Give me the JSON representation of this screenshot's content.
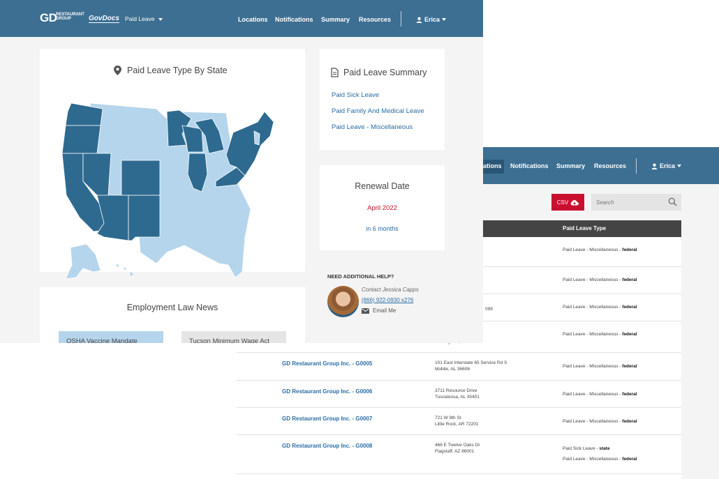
{
  "back_window": {
    "nav": {
      "items": [
        "ations",
        "Notifications",
        "Summary",
        "Resources"
      ],
      "user": "Erica"
    },
    "toolbar": {
      "csv_label": "CSV",
      "search_placeholder": "Search"
    },
    "table": {
      "header_type": "Paid Leave Type",
      "partial_rows": [
        {
          "address_line": "",
          "types": [
            {
              "category": "Paid Leave - Miscellaneous",
              "level": "federal"
            }
          ]
        },
        {
          "address_line": "",
          "types": [
            {
              "category": "Paid Leave - Miscellaneous",
              "level": "federal"
            }
          ]
        },
        {
          "address_line": "099",
          "types": [
            {
              "category": "Paid Leave - Miscellaneous",
              "level": "federal"
            }
          ]
        },
        {
          "address_line": "Birmingham, AL 35209",
          "types": [
            {
              "category": "Paid Leave - Miscellaneous",
              "level": "federal"
            }
          ]
        }
      ],
      "rows": [
        {
          "name": "GD Restaurant Group Inc. - G0005",
          "address1": "101 East Interstate 65 Service Rd S",
          "address2": "Mobile, AL 36606",
          "types": [
            {
              "category": "Paid Leave - Miscellaneous",
              "level": "federal"
            }
          ]
        },
        {
          "name": "GD Restaurant Group Inc. - G0006",
          "address1": "3711 Resource Drive",
          "address2": "Tuscaloosa, AL 35401",
          "types": [
            {
              "category": "Paid Leave - Miscellaneous",
              "level": "federal"
            }
          ]
        },
        {
          "name": "GD Restaurant Group Inc. - G0007",
          "address1": "721 W 9th St",
          "address2": "Little Rock, AR 72201",
          "types": [
            {
              "category": "Paid Leave - Miscellaneous",
              "level": "federal"
            }
          ]
        },
        {
          "name": "GD Restaurant Group Inc. - G0008",
          "address1": "466 E Twelve Oaks Dr",
          "address2": "Flagstaff, AZ 86001",
          "types": [
            {
              "category": "Paid Sick Leave",
              "level": "state"
            },
            {
              "category": "Paid Leave - Miscellaneous",
              "level": "federal"
            }
          ]
        }
      ],
      "separator": " - "
    }
  },
  "front_window": {
    "nav": {
      "logo_mark": "GD",
      "logo_text_1": "RESTAURANT",
      "logo_text_2": "GROUP",
      "app_name": "GovDocs",
      "module": "Paid Leave",
      "items": [
        "Locations",
        "Notifications",
        "Summary",
        "Resources"
      ],
      "user": "Erica"
    },
    "map_card": {
      "title": "Paid Leave Type By State"
    },
    "summary_card": {
      "title": "Paid Leave Summary",
      "links": [
        "Paid Sick Leave",
        "Paid Family And Medical Leave",
        "Paid Leave - Miscellaneous"
      ]
    },
    "renewal_card": {
      "title": "Renewal Date",
      "date": "April 2022",
      "remaining": "in 6 months"
    },
    "help": {
      "heading": "NEED ADDITIONAL HELP?",
      "contact": "Contact Jessica Capps",
      "phone": "(866) 922-0930 x276",
      "email_label": "Email Me"
    },
    "news_card": {
      "title": "Employment Law News",
      "items": [
        "OSHA Vaccine Mandate",
        "Tucson Minimum Wage Act"
      ]
    }
  },
  "colors": {
    "nav_bg": "#3d6f92",
    "state_dark": "#2e6a90",
    "state_light": "#b5d5ec",
    "link": "#2b6ca3",
    "renewal_red": "#c8102e",
    "news_active": "#b5d5ec"
  }
}
